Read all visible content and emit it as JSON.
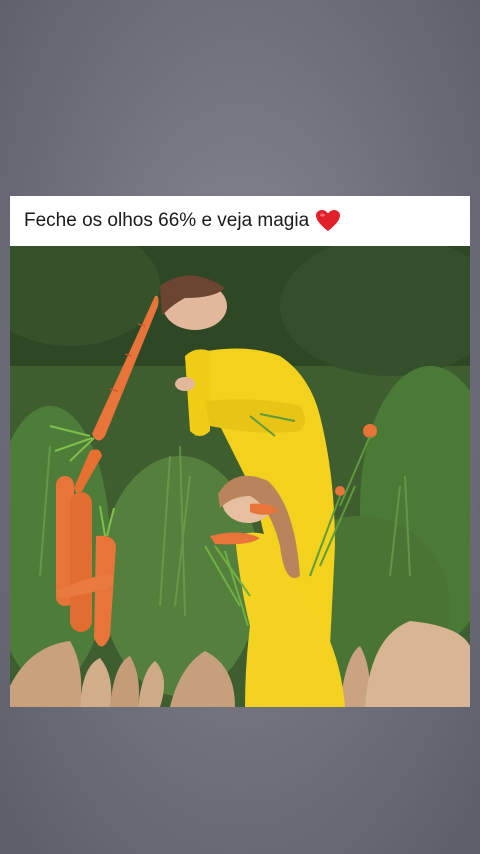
{
  "post": {
    "caption": "Feche os olhos 66% e veja magia",
    "heart_icon": "heart-icon",
    "image_icon": "optical-illusion-photo"
  },
  "colors": {
    "background": "#6f707c",
    "card": "#ffffff",
    "heart": "#e0202a",
    "dress": "#f2d21c",
    "carrot": "#e8743a",
    "foliage": "#4a7a34"
  }
}
